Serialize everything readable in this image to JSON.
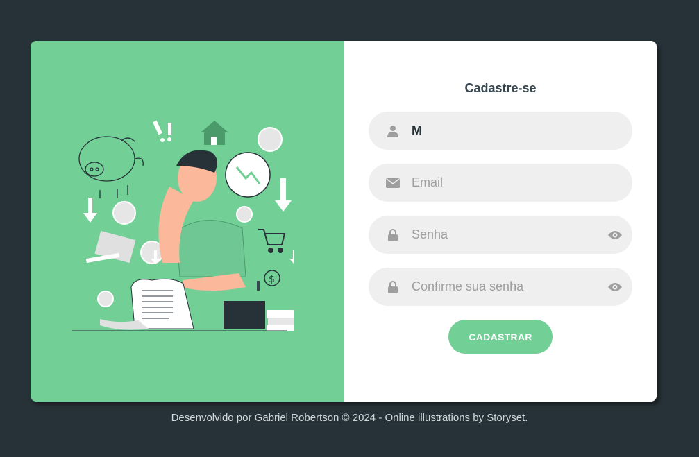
{
  "signup": {
    "title": "Cadastre-se",
    "name_value": "M",
    "email_placeholder": "Email",
    "password_placeholder": "Senha",
    "confirm_placeholder": "Confirme sua senha",
    "submit_label": "CADASTRAR"
  },
  "footer": {
    "prefix": "Desenvolvido por ",
    "author_link": "Gabriel Robertson",
    "middle": " © 2024 - ",
    "credit_link": "Online illustrations by Storyset",
    "suffix": "."
  },
  "icons": {
    "name": "user-icon",
    "email": "envelope-icon",
    "password": "lock-icon",
    "toggle": "eye-icon"
  },
  "colors": {
    "background": "#263238",
    "accent": "#72cf96",
    "field": "#efefef",
    "icon": "#9e9e9e"
  }
}
